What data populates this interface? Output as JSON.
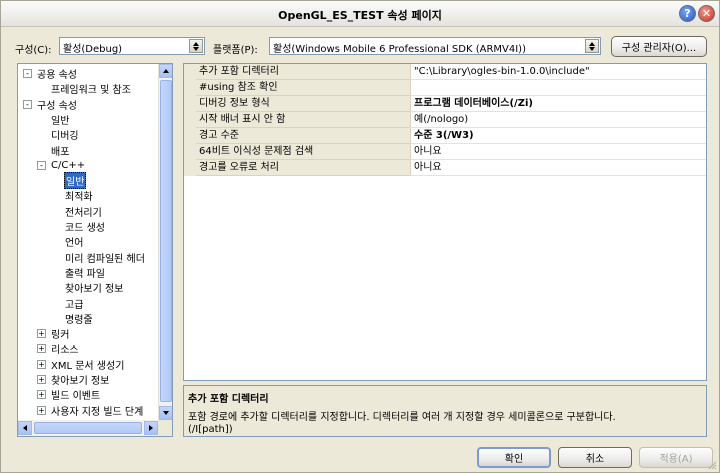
{
  "window": {
    "title": "OpenGL_ES_TEST 속성 페이지"
  },
  "toolbar": {
    "config_label": "구성(C):",
    "config_value": "활성(Debug)",
    "platform_label": "플랫폼(P):",
    "platform_value": "활성(Windows Mobile 6 Professional SDK (ARMV4I))",
    "config_manager_button": "구성 관리자(O)..."
  },
  "tree": {
    "items": [
      {
        "label": "공용 속성",
        "expander": "-"
      },
      {
        "label": "프레임워크 및 참조"
      },
      {
        "label": "구성 속성",
        "expander": "-"
      },
      {
        "label": "일반"
      },
      {
        "label": "디버깅"
      },
      {
        "label": "배포"
      },
      {
        "label": "C/C++",
        "expander": "-"
      },
      {
        "label": "일반",
        "selected": true
      },
      {
        "label": "최적화"
      },
      {
        "label": "전처리기"
      },
      {
        "label": "코드 생성"
      },
      {
        "label": "언어"
      },
      {
        "label": "미리 컴파일된 헤더"
      },
      {
        "label": "출력 파일"
      },
      {
        "label": "찾아보기 정보"
      },
      {
        "label": "고급"
      },
      {
        "label": "명령줄"
      },
      {
        "label": "링커",
        "expander": "+"
      },
      {
        "label": "리소스",
        "expander": "+"
      },
      {
        "label": "XML 문서 생성기",
        "expander": "+"
      },
      {
        "label": "찾아보기 정보",
        "expander": "+"
      },
      {
        "label": "빌드 이벤트",
        "expander": "+"
      },
      {
        "label": "사용자 지정 빌드 단계",
        "expander": "+"
      }
    ]
  },
  "grid": {
    "rows": [
      {
        "name": "추가 포함 디렉터리",
        "value": "\"C:\\Library\\ogles-bin-1.0.0\\include\"",
        "bold": false
      },
      {
        "name": "#using 참조 확인",
        "value": "",
        "bold": false
      },
      {
        "name": "디버깅 정보 형식",
        "value": "프로그램 데이터베이스(/Zi)",
        "bold": true
      },
      {
        "name": "시작 배너 표시 안 함",
        "value": "예(/nologo)",
        "bold": false
      },
      {
        "name": "경고 수준",
        "value": "수준 3(/W3)",
        "bold": true
      },
      {
        "name": "64비트 이식성 문제점 검색",
        "value": "아니요",
        "bold": false
      },
      {
        "name": "경고를 오류로 처리",
        "value": "아니요",
        "bold": false
      }
    ]
  },
  "description": {
    "title": "추가 포함 디렉터리",
    "line1": "포함 경로에 추가할 디렉터리를 지정합니다. 디렉터리를 여러 개 지정할 경우 세미콜론으로 구분합니다.",
    "line2": "(/I[path])"
  },
  "buttons": {
    "ok": "확인",
    "cancel": "취소",
    "apply": "적용(A)"
  }
}
